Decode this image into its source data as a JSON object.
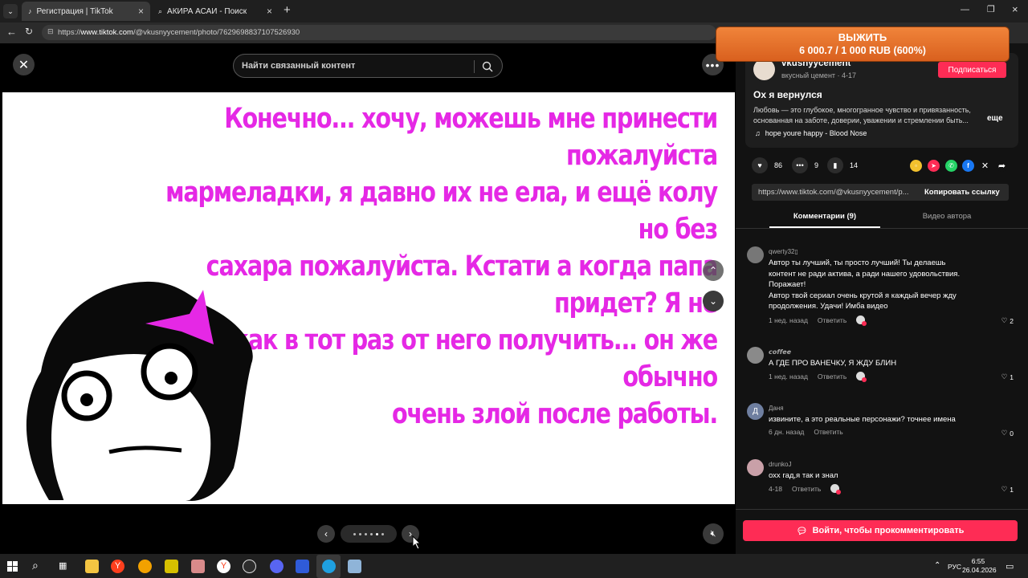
{
  "browser": {
    "tabs": [
      {
        "title": "Регистрация | TikTok",
        "icon": "tiktok-icon",
        "active": true
      },
      {
        "title": "АКИРА АСАИ - Поиск",
        "icon": "search-icon",
        "active": false
      }
    ],
    "url_prefix": "https://",
    "url_host": "www.tiktok.com",
    "url_path": "/@vkusnyycement/photo/7629698837107526930"
  },
  "viewer": {
    "search_placeholder": "Найти связанный контент",
    "slide_text": "Конечно... хочу, можешь мне принести пожалуйста\nмармеладки, я давно их не ела, и ещё колу но без\nсахара пожалуйста. Кстати а когда папа придет? Я не\nхочу как в тот раз от него получить... он же обычно\nочень злой после работы."
  },
  "promo": {
    "title": "ВЫЖИТЬ",
    "subtitle": "6 000.7 / 1 000 RUB (600%)"
  },
  "author": {
    "username": "vkusnyycement",
    "display_name": "вкусный цемент",
    "date": "4-17",
    "follow_label": "Подписаться",
    "post_title": "Ох я вернулся",
    "description": "Любовь — это глубокое, многогранное чувство и привязанность, основанная на заботе, доверии, уважении и стремлении быть...",
    "more_label": "еще",
    "music": "hope youre happy - Blood Nose"
  },
  "stats": {
    "likes": "86",
    "comments": "9",
    "saves": "14"
  },
  "link": {
    "url": "https://www.tiktok.com/@vkusnyycement/p...",
    "copy_label": "Копировать ссылку"
  },
  "tabs": {
    "comments": "Комментарии (9)",
    "videos": "Видео автора"
  },
  "comments": [
    {
      "name": "qwerty32▯",
      "text": "Автор ты лучший, ты просто лучший! Ты делаешь\nконтент не ради актива, а ради нашего удовольствия.\nПоражает!\nАвтор твой сериал очень крутой я каждый вечер жду\nпродолжения. Удачи! Имба видео",
      "time": "1 нед. назад",
      "reply": "Ответить",
      "likes": "2",
      "avatar_color": "#777777"
    },
    {
      "name": "𝙘𝙤𝙛𝙛𝙚𝙚",
      "text": "А ГДЕ ПРО ВАНЕЧКУ, Я ЖДУ БЛИН",
      "time": "1 нед. назад",
      "reply": "Ответить",
      "likes": "1",
      "avatar_color": "#8a8a8a"
    },
    {
      "name": "Даня",
      "text": "извините, а это реальные персонажи? точнее имена",
      "time": "6 дн. назад",
      "reply": "Ответить",
      "likes": "0",
      "avatar_color": "#6f7fa0",
      "avatar_letter": "Д"
    },
    {
      "name": "drunkoJ",
      "text": "охх гад,я так и знал",
      "time": "4-18",
      "reply": "Ответить",
      "likes": "1",
      "avatar_color": "#c9a0a8"
    }
  ],
  "login_label": "Войти, чтобы прокомментировать",
  "taskbar": {
    "lang": "РУС",
    "time": "6:55",
    "date": "26.04.2026"
  }
}
